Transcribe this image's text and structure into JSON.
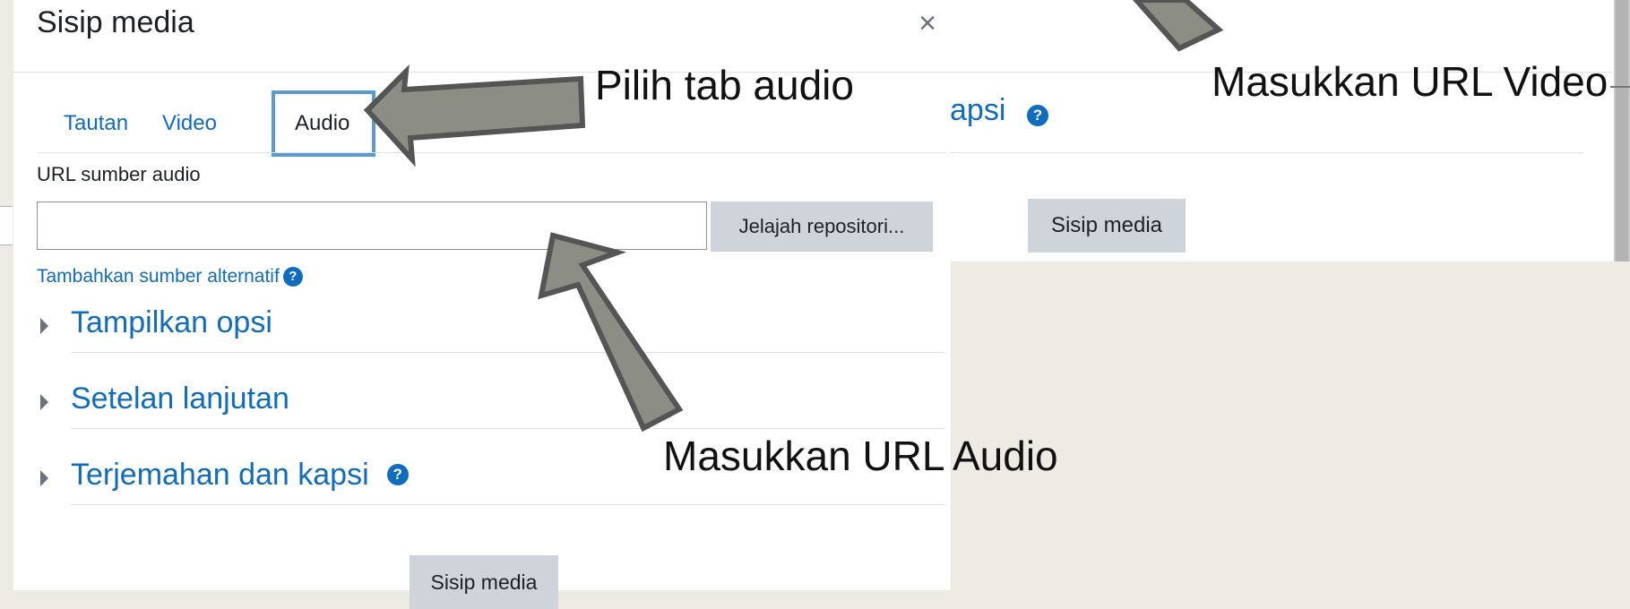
{
  "background_dialog": {
    "partial_section_title": "apsi",
    "insert_button": "Sisip media"
  },
  "modal": {
    "title": "Sisip media",
    "close": "×",
    "tabs": [
      {
        "label": "Tautan",
        "active": false
      },
      {
        "label": "Video",
        "active": false
      },
      {
        "label": "Audio",
        "active": true
      }
    ],
    "url_label": "URL sumber audio",
    "url_value": "",
    "browse_button": "Jelajah repositori...",
    "add_alternative": "Tambahkan sumber alternatif",
    "sections": [
      {
        "title": "Tampilkan opsi"
      },
      {
        "title": "Setelan lanjutan"
      },
      {
        "title": "Terjemahan dan kapsi"
      }
    ],
    "insert_button": "Sisip media"
  },
  "annotations": {
    "choose_tab": "Pilih tab audio",
    "enter_video_url": "Masukkan URL Video",
    "enter_audio_url": "Masukkan URL Audio"
  },
  "colors": {
    "link": "#0f6cbf",
    "button_bg": "#ced4da",
    "arrow_fill": "#8c8e85",
    "arrow_stroke": "#555555",
    "highlight_border": "#5a9bd5",
    "page_bg": "#edebe4"
  },
  "icons": [
    "close-icon",
    "help-icon",
    "caret-right-icon",
    "arrow-annotation"
  ]
}
